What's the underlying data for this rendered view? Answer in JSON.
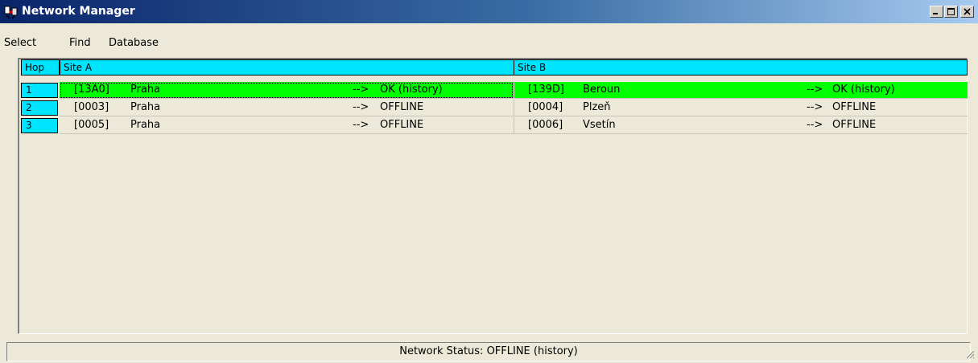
{
  "window": {
    "title": "Network Manager"
  },
  "menu": [
    "Select",
    "Find",
    "Database"
  ],
  "table": {
    "headers": {
      "hop": "Hop",
      "site_a": "Site A",
      "site_b": "Site B"
    },
    "rows": [
      {
        "hop": "1",
        "a": {
          "code": "[13A0]",
          "name": "Praha",
          "arrow": "-->",
          "status": "OK  (history)"
        },
        "b": {
          "code": "[139D]",
          "name": "Beroun",
          "arrow": "-->",
          "status": "OK  (history)"
        },
        "selected": true
      },
      {
        "hop": "2",
        "a": {
          "code": "[0003]",
          "name": "Praha",
          "arrow": "-->",
          "status": "OFFLINE"
        },
        "b": {
          "code": "[0004]",
          "name": "Plzeň",
          "arrow": "-->",
          "status": "OFFLINE"
        },
        "selected": false
      },
      {
        "hop": "3",
        "a": {
          "code": "[0005]",
          "name": "Praha",
          "arrow": "-->",
          "status": "OFFLINE"
        },
        "b": {
          "code": "[0006]",
          "name": "Vsetín",
          "arrow": "-->",
          "status": "OFFLINE"
        },
        "selected": false
      }
    ]
  },
  "status_bar": {
    "text": "Network Status: OFFLINE (history)"
  },
  "colors": {
    "header": "#00e5ff",
    "ok_row": "#00ff00",
    "window_bg": "#ece9d8"
  },
  "icons": {
    "app": "network-app-icon",
    "minimize": "minimize-icon",
    "maximize": "maximize-icon",
    "close": "close-icon",
    "grip": "resize-grip-icon"
  }
}
